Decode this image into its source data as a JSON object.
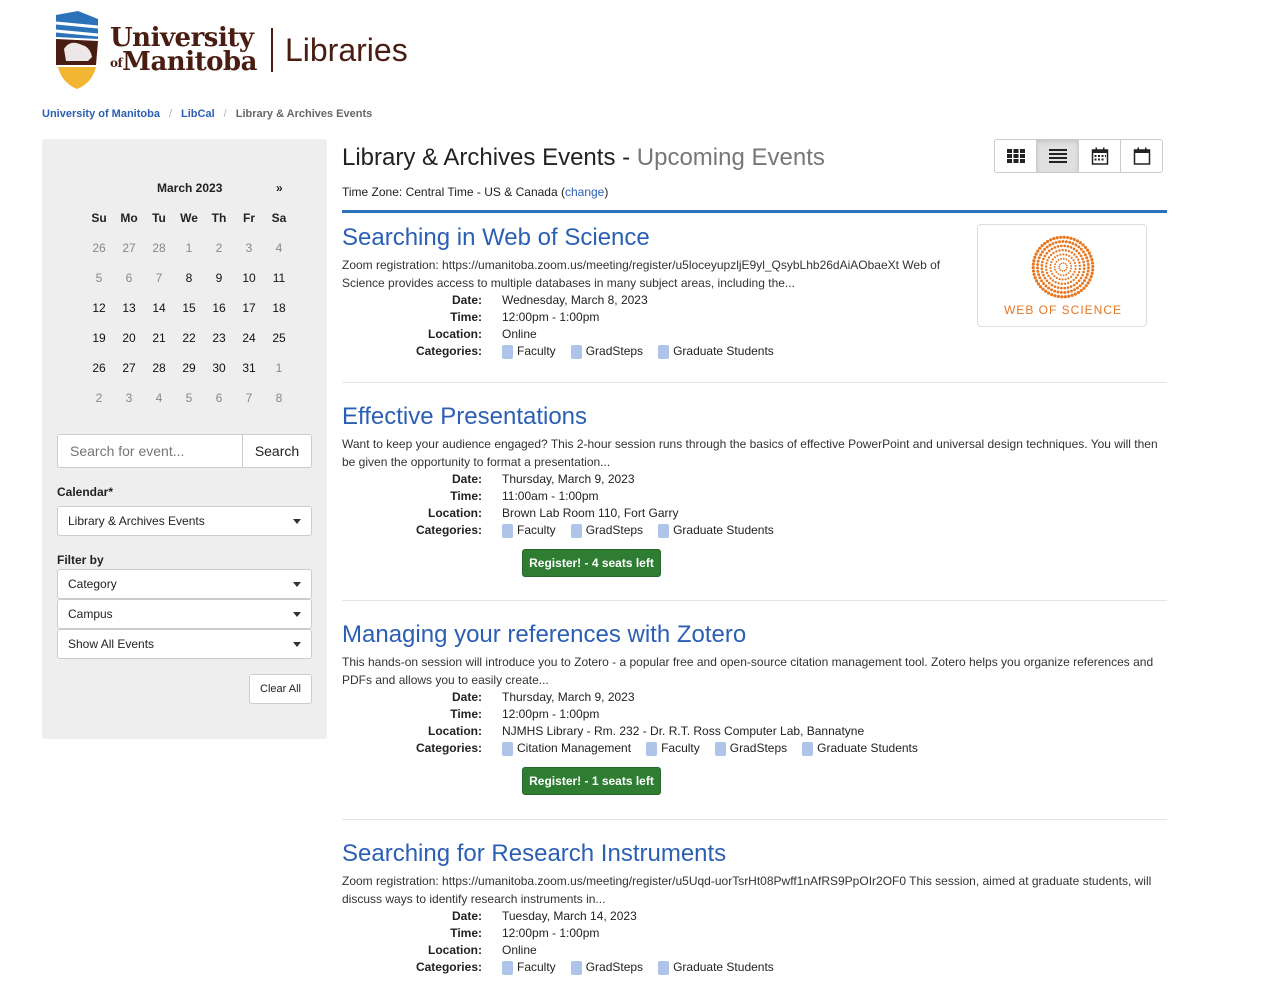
{
  "logo": {
    "line1": "University",
    "of": "of",
    "line2": "Manitoba",
    "libraries": "Libraries"
  },
  "breadcrumb": [
    {
      "label": "University of Manitoba"
    },
    {
      "label": "LibCal"
    },
    {
      "label": "Library & Archives Events"
    }
  ],
  "calendar": {
    "month": "March 2023",
    "next": "»",
    "dow": [
      "Su",
      "Mo",
      "Tu",
      "We",
      "Th",
      "Fr",
      "Sa"
    ],
    "weeks": [
      [
        [
          "26",
          "muted"
        ],
        [
          "27",
          "muted"
        ],
        [
          "28",
          "muted"
        ],
        [
          "1",
          "muted"
        ],
        [
          "2",
          "muted"
        ],
        [
          "3",
          "muted"
        ],
        [
          "4",
          "muted"
        ]
      ],
      [
        [
          "5",
          "muted"
        ],
        [
          "6",
          "muted"
        ],
        [
          "7",
          "muted"
        ],
        [
          "8",
          "active"
        ],
        [
          "9",
          "active"
        ],
        [
          "10",
          "active"
        ],
        [
          "11",
          "active"
        ]
      ],
      [
        [
          "12",
          "active"
        ],
        [
          "13",
          "active"
        ],
        [
          "14",
          "active"
        ],
        [
          "15",
          "active"
        ],
        [
          "16",
          "active"
        ],
        [
          "17",
          "active"
        ],
        [
          "18",
          "active"
        ]
      ],
      [
        [
          "19",
          "active"
        ],
        [
          "20",
          "active"
        ],
        [
          "21",
          "active"
        ],
        [
          "22",
          "active"
        ],
        [
          "23",
          "active"
        ],
        [
          "24",
          "active"
        ],
        [
          "25",
          "active"
        ]
      ],
      [
        [
          "26",
          "active"
        ],
        [
          "27",
          "active"
        ],
        [
          "28",
          "active"
        ],
        [
          "29",
          "active"
        ],
        [
          "30",
          "active"
        ],
        [
          "31",
          "active"
        ],
        [
          "1",
          "muted"
        ]
      ],
      [
        [
          "2",
          "muted"
        ],
        [
          "3",
          "muted"
        ],
        [
          "4",
          "muted"
        ],
        [
          "5",
          "muted"
        ],
        [
          "6",
          "muted"
        ],
        [
          "7",
          "muted"
        ],
        [
          "8",
          "muted"
        ]
      ]
    ]
  },
  "search": {
    "placeholder": "Search for event...",
    "button": "Search"
  },
  "filters": {
    "calendar_label": "Calendar*",
    "calendar_value": "Library & Archives Events",
    "filter_label": "Filter by",
    "category": "Category",
    "campus": "Campus",
    "show": "Show All Events",
    "clear": "Clear All"
  },
  "header": {
    "title": "Library & Archives Events",
    "dash": " - ",
    "subtitle": "Upcoming Events",
    "tz_prefix": "Time Zone: Central Time - US & Canada (",
    "tz_link": "change",
    "tz_suffix": ")"
  },
  "labels": {
    "date": "Date:",
    "time": "Time:",
    "location": "Location:",
    "categories": "Categories:"
  },
  "wos_image": {
    "caption": "WEB OF SCIENCE"
  },
  "events": [
    {
      "title": "Searching in Web of Science",
      "desc": "Zoom registration: https://umanitoba.zoom.us/meeting/register/u5loceyupzljE9yl_QsybLhb26dAiAObaeXt Web of Science provides access to multiple databases in many subject areas, including the...",
      "date": "Wednesday, March 8, 2023",
      "time": "12:00pm - 1:00pm",
      "location": "Online",
      "categories": [
        "Faculty",
        "GradSteps",
        "Graduate Students"
      ],
      "register": ""
    },
    {
      "title": "Effective Presentations",
      "desc": "Want to keep your audience engaged? This 2-hour session runs through the basics of effective PowerPoint and universal design techniques. You will then be given the opportunity to format a presentation...",
      "date": "Thursday, March 9, 2023",
      "time": "11:00am - 1:00pm",
      "location": "Brown Lab Room 110, Fort Garry",
      "categories": [
        "Faculty",
        "GradSteps",
        "Graduate Students"
      ],
      "register": "Register! - 4 seats left"
    },
    {
      "title": "Managing your references with Zotero",
      "desc": "This hands-on session will introduce you to Zotero - a popular free and open-source citation management tool. Zotero helps you organize references and PDFs and allows you to easily create...",
      "date": "Thursday, March 9, 2023",
      "time": "12:00pm - 1:00pm",
      "location": "NJMHS Library - Rm. 232 - Dr. R.T. Ross Computer Lab, Bannatyne",
      "categories": [
        "Citation Management",
        "Faculty",
        "GradSteps",
        "Graduate Students"
      ],
      "register": "Register! - 1 seats left"
    },
    {
      "title": "Searching for Research Instruments",
      "desc": "Zoom registration: https://umanitoba.zoom.us/meeting/register/u5Uqd-uorTsrHt08Pwff1nAfRS9PpOIr2OF0 This session, aimed at graduate students, will discuss ways to identify research instruments in...",
      "date": "Tuesday, March 14, 2023",
      "time": "12:00pm - 1:00pm",
      "location": "Online",
      "categories": [
        "Faculty",
        "GradSteps",
        "Graduate Students"
      ],
      "register": ""
    }
  ],
  "colors": {
    "link": "#2b5fb4",
    "brand": "#4a1d12",
    "rule": "#2b72b8",
    "register": "#2e7d32",
    "category": "#aec4e8",
    "wos": "#e87722"
  }
}
